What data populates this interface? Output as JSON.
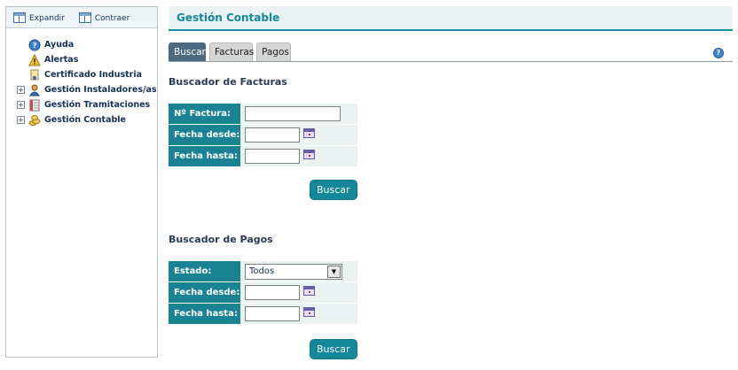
{
  "sidebar": {
    "toolbar": {
      "expand_label": "Expandir",
      "collapse_label": "Contraer"
    },
    "items": [
      {
        "label": "Ayuda",
        "icon": "help-icon",
        "expandable": false
      },
      {
        "label": "Alertas",
        "icon": "warning-icon",
        "expandable": false
      },
      {
        "label": "Certificado Industria",
        "icon": "certificate-icon",
        "expandable": false
      },
      {
        "label": "Gestión Instaladores/as",
        "icon": "user-icon",
        "expandable": true
      },
      {
        "label": "Gestión Tramitaciones",
        "icon": "document-icon",
        "expandable": true
      },
      {
        "label": "Gestión Contable",
        "icon": "coins-icon",
        "expandable": true
      }
    ]
  },
  "header": {
    "title": "Gestión Contable"
  },
  "tabs": [
    {
      "label": "Buscar",
      "active": true
    },
    {
      "label": "Facturas",
      "active": false
    },
    {
      "label": "Pagos",
      "active": false
    }
  ],
  "facturas": {
    "title": "Buscador de Facturas",
    "factura_label": "Nº Factura:",
    "factura_value": "",
    "desde_label": "Fecha desde:",
    "desde_value": "",
    "hasta_label": "Fecha hasta:",
    "hasta_value": "",
    "button": "Buscar"
  },
  "pagos": {
    "title": "Buscador de Pagos",
    "estado_label": "Estado:",
    "estado_value": "Todos",
    "desde_label": "Fecha desde:",
    "desde_value": "",
    "hasta_label": "Fecha hasta:",
    "hasta_value": "",
    "button": "Buscar"
  },
  "colors": {
    "accent": "#1a8393",
    "header_text": "#13889c",
    "tab_active": "#4e6a80"
  }
}
